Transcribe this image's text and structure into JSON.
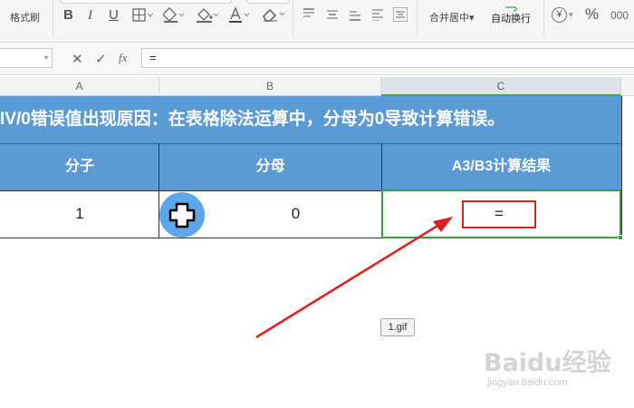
{
  "ribbon": {
    "format_painter_label": "格式刷",
    "merge_center_label": "合并居中",
    "wrap_text_label": "自动换行",
    "bold_glyph": "B",
    "italic_glyph": "I",
    "underline_glyph": "U",
    "percent_glyph": "%",
    "currency_glyph": "¥",
    "dropdown_glyph": "▾",
    "icons": [
      "format-painter-icon",
      "bold-icon",
      "italic-icon",
      "underline-icon",
      "borders-icon",
      "fill-color-icon",
      "font-color-icon",
      "clear-format-icon",
      "align-top-icon",
      "align-middle-icon",
      "align-bottom-icon",
      "align-left-icon",
      "align-center-icon",
      "align-right-icon",
      "merge-center-icon",
      "wrap-text-icon",
      "currency-icon",
      "percent-icon"
    ]
  },
  "formula_bar": {
    "name_box_value": "",
    "cancel_glyph": "✕",
    "confirm_glyph": "✓",
    "fx_label": "fx",
    "formula_value": "="
  },
  "columns": [
    "A",
    "B",
    "C"
  ],
  "sheet": {
    "title": "IV/0错误值出现原因：在表格除法运算中，分母为0导致计算错误。",
    "headers": [
      "分子",
      "分母",
      "A3/B3计算结果"
    ],
    "row": [
      "1",
      "0",
      "="
    ]
  },
  "overlay": {
    "gif_label": "1.gif",
    "watermark_main": "Baidu经验",
    "watermark_sub": "jingyan.baidu.com",
    "cursor_glyph": "✚"
  },
  "colors": {
    "header_fill": "#5b9bd5",
    "selection_border": "#3c9a3f",
    "annotation_red": "#e02020",
    "cursor_circle": "#5ea6ea"
  }
}
